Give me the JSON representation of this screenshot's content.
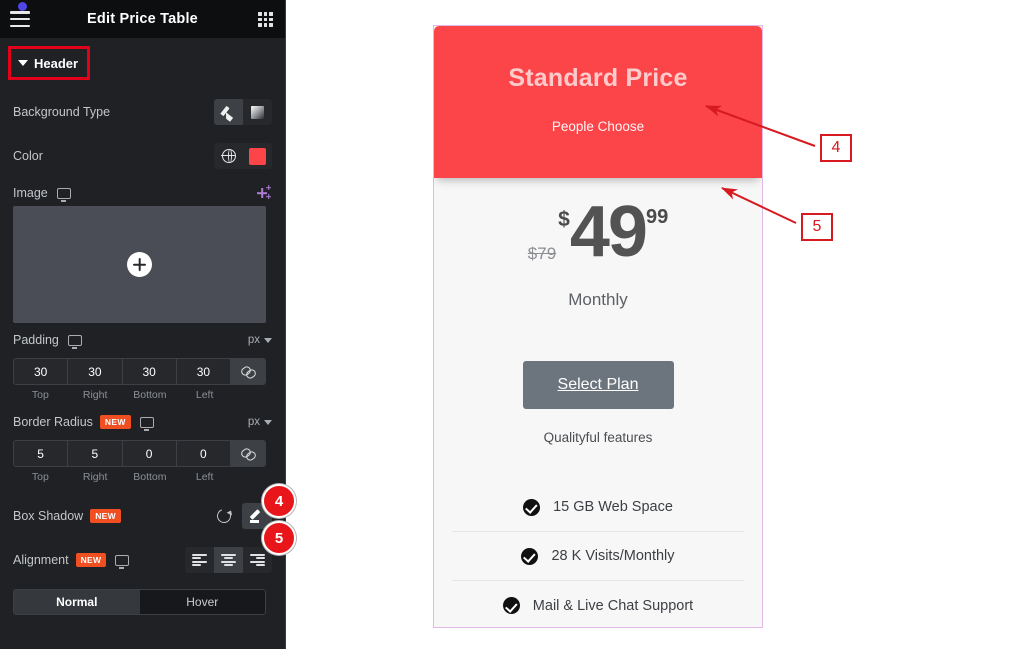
{
  "panel": {
    "title": "Edit Price Table",
    "menu_icon": "hamburger-icon",
    "apps_icon": "grid-apps-icon",
    "section": {
      "label": "Header",
      "expanded": true
    },
    "rows": {
      "background_type": {
        "label": "Background Type",
        "options": [
          "classic-brush",
          "gradient"
        ],
        "selected": "classic-brush"
      },
      "color": {
        "label": "Color",
        "globe_icon": "globe-icon",
        "swatch_hex": "#f9474b"
      },
      "image": {
        "label": "Image",
        "responsive_icon": "monitor-icon",
        "ai_icon": "sparkle-icon",
        "upload_icon": "plus-circle-icon"
      },
      "padding": {
        "label": "Padding",
        "unit": "px",
        "values": [
          "30",
          "30",
          "30",
          "30"
        ],
        "sides": [
          "Top",
          "Right",
          "Bottom",
          "Left"
        ],
        "linked": true
      },
      "border_radius": {
        "label": "Border Radius",
        "badge": "NEW",
        "unit": "px",
        "values": [
          "5",
          "5",
          "0",
          "0"
        ],
        "sides": [
          "Top",
          "Right",
          "Bottom",
          "Left"
        ],
        "linked": true
      },
      "box_shadow": {
        "label": "Box Shadow",
        "badge": "NEW",
        "reset_icon": "reset-icon",
        "edit_icon": "pencil-icon"
      },
      "alignment": {
        "label": "Alignment",
        "badge": "NEW",
        "options": [
          "align-left",
          "align-center",
          "align-right"
        ],
        "selected": "align-center"
      }
    },
    "state_tabs": [
      {
        "label": "Normal",
        "active": true
      },
      {
        "label": "Hover",
        "active": false
      }
    ],
    "collapse_handle_icon": "chevron-left-icon",
    "edge_badges": [
      "4",
      "5"
    ]
  },
  "card": {
    "title": "Standard Price",
    "subtitle": "People Choose",
    "original_price": "$79",
    "currency": "$",
    "price_integer": "49",
    "price_decimal": "99",
    "period": "Monthly",
    "cta_label": "Select Plan",
    "features_heading": "Qualityful features",
    "features": [
      {
        "icon": "check-circle-icon",
        "text": "15 GB Web Space"
      },
      {
        "icon": "check-circle-icon",
        "text": "28 K Visits/Monthly"
      },
      {
        "icon": "check-circle-icon",
        "text": "Mail & Live Chat Support"
      }
    ],
    "header_bg_hex": "#fb4549",
    "border_hex": "#e3b9e8",
    "cta_bg_hex": "#6c757d"
  },
  "annotations": [
    {
      "number": "4",
      "target": "card-header-area"
    },
    {
      "number": "5",
      "target": "card-header-shadow-edge"
    }
  ]
}
